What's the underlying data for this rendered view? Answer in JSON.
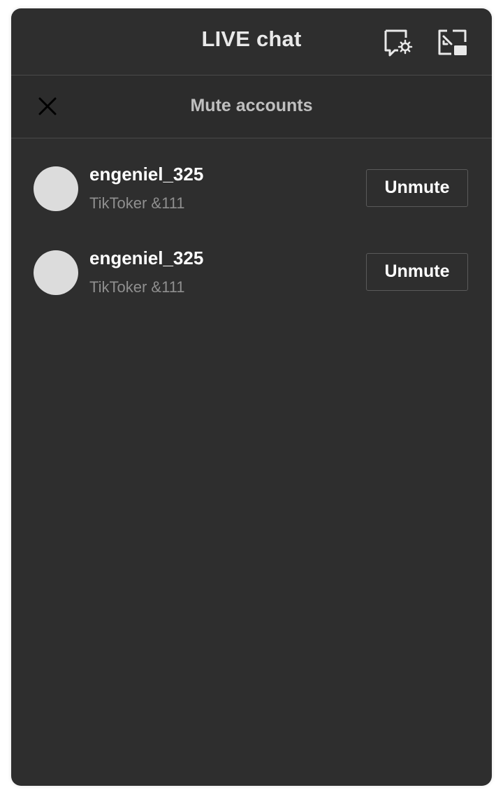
{
  "header": {
    "title": "LIVE chat",
    "icons": [
      "chat-settings-icon",
      "popout-icon"
    ]
  },
  "subheader": {
    "title": "Mute accounts",
    "close_icon": "close-icon"
  },
  "muted_accounts": [
    {
      "username": "engeniel_325",
      "subtitle": "TikToker &111",
      "button_label": "Unmute"
    },
    {
      "username": "engeniel_325",
      "subtitle": "TikToker &111",
      "button_label": "Unmute"
    }
  ],
  "colors": {
    "panel_background": "#2e2e2e",
    "avatar_placeholder": "#dcdcdc",
    "primary_text": "#ffffff",
    "secondary_text": "#8f8f8f"
  }
}
